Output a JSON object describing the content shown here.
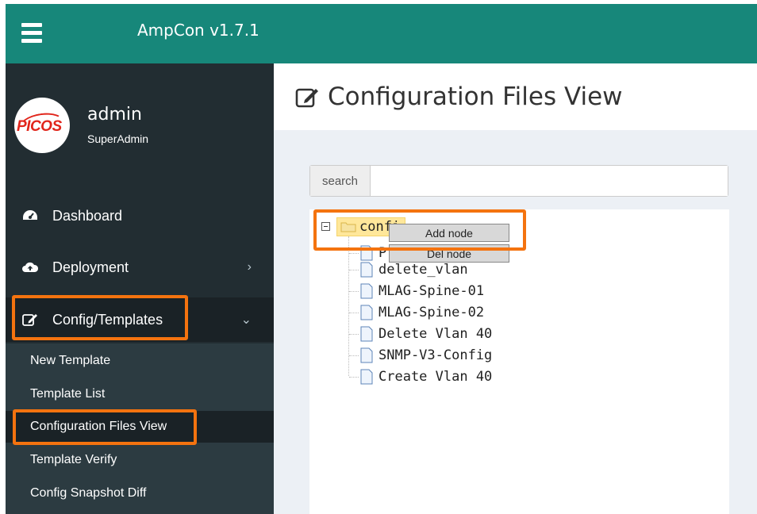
{
  "topbar": {
    "app_title": "AmpCon v1.7.1",
    "background_color": "#17877a"
  },
  "user": {
    "logo_text_main": "PICOS",
    "name": "admin",
    "role": "SuperAdmin"
  },
  "sidebar": {
    "items": [
      {
        "label": "Dashboard",
        "icon": "dashboard-icon"
      },
      {
        "label": "Deployment",
        "icon": "cloud-upload-icon",
        "chevron": "›"
      },
      {
        "label": "Config/Templates",
        "icon": "edit-icon",
        "chevron": "⌄"
      }
    ],
    "submenu": [
      {
        "label": "New Template"
      },
      {
        "label": "Template List"
      },
      {
        "label": "Configuration Files View"
      },
      {
        "label": "Template Verify"
      },
      {
        "label": "Config Snapshot Diff"
      }
    ]
  },
  "main": {
    "page_title": "Configuration Files View",
    "search": {
      "addon_label": "search",
      "value": "",
      "placeholder": ""
    },
    "tree": {
      "root_label": "confi",
      "children": [
        {
          "label": "P"
        },
        {
          "label": "delete_vlan"
        },
        {
          "label": "MLAG-Spine-01"
        },
        {
          "label": "MLAG-Spine-02"
        },
        {
          "label": "Delete Vlan 40"
        },
        {
          "label": "SNMP-V3-Config"
        },
        {
          "label": "Create Vlan 40"
        }
      ]
    },
    "context_menu": {
      "add_label": "Add node",
      "del_label": "Del node"
    }
  },
  "highlight_color": "#f4730f"
}
